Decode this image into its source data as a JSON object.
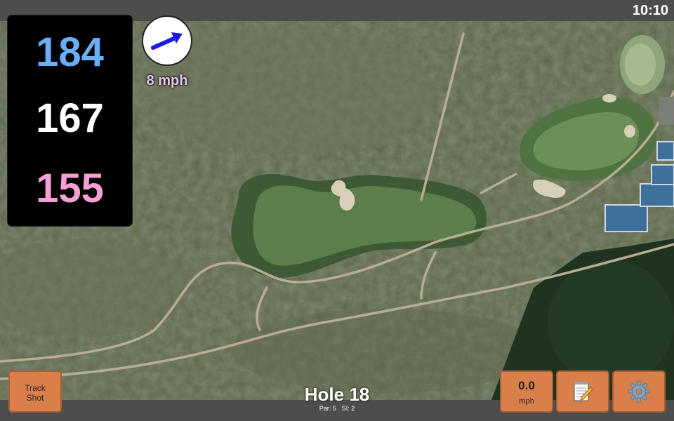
{
  "status": {
    "time": "10:10"
  },
  "distances": {
    "back": "184",
    "middle": "167",
    "front": "155"
  },
  "wind": {
    "speed_label": "8 mph",
    "icon": "wind-arrow-icon",
    "direction": "east-northeast"
  },
  "hole": {
    "title": "Hole 18",
    "par": "Par: 5",
    "stroke_index": "SI: 2"
  },
  "buttons": {
    "track_shot": {
      "line1": "Track",
      "line2": "Shot"
    },
    "wind_readout": {
      "value": "0.0",
      "unit": "mph"
    },
    "notes": {
      "icon": "notepad-pencil-icon"
    },
    "settings": {
      "icon": "gear-icon"
    }
  },
  "colors": {
    "back_distance": "#6aaef6",
    "middle_distance": "#ffffff",
    "front_distance": "#f59fd2",
    "button": "#d9804a",
    "wind_arrow": "#1a1ae0",
    "wind_speed_text": "#e9c8f0"
  }
}
